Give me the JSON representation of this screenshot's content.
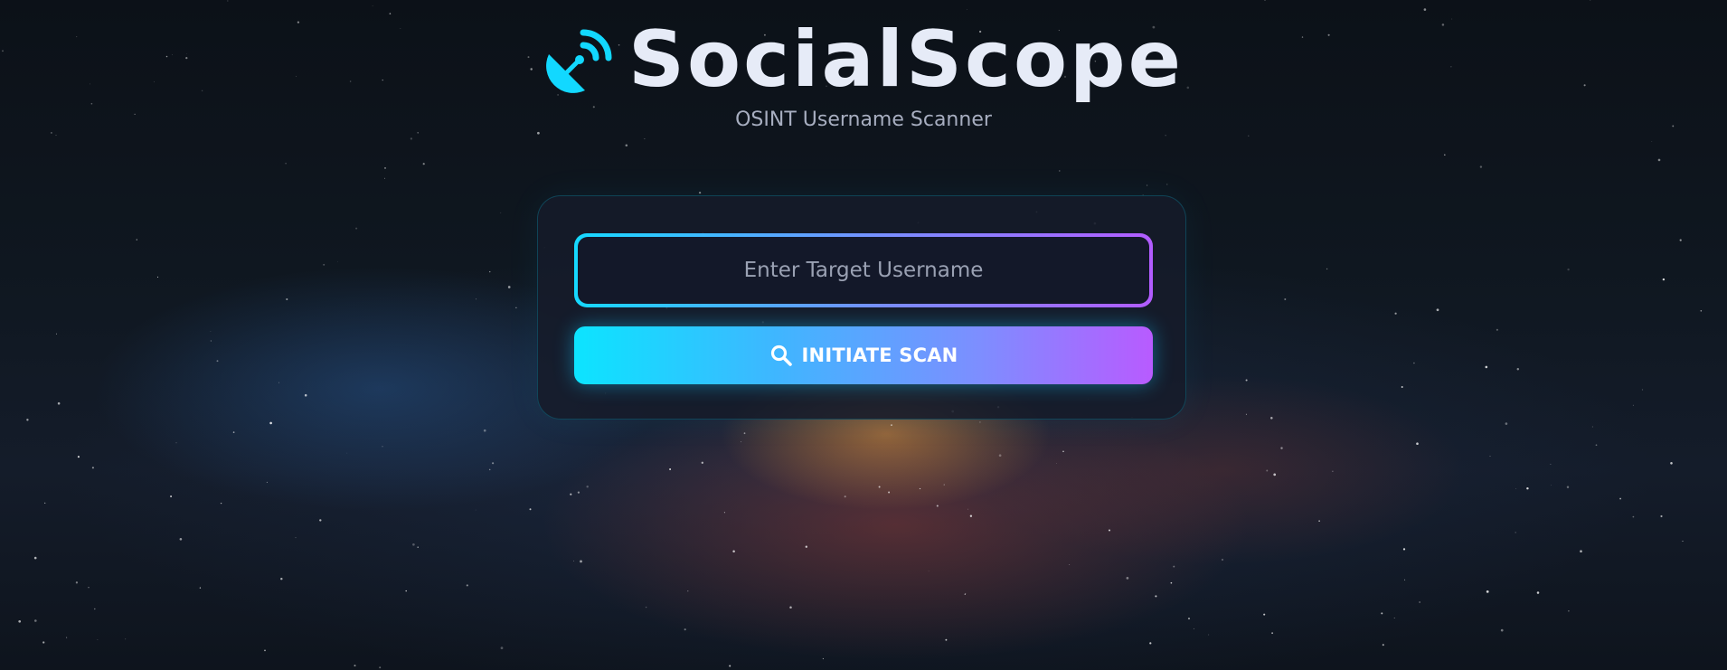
{
  "header": {
    "title": "SocialScope",
    "subtitle": "OSINT Username Scanner",
    "icon": "satellite-dish-icon"
  },
  "form": {
    "username_placeholder": "Enter Target Username",
    "username_value": "",
    "scan_label": "INITIATE SCAN",
    "scan_icon": "search-icon"
  },
  "colors": {
    "accent_cyan": "#0ce4ff",
    "accent_purple": "#b85bff",
    "title": "#e6ebf7",
    "subtitle": "#a7aec0",
    "card_bg": "#161b2a"
  }
}
